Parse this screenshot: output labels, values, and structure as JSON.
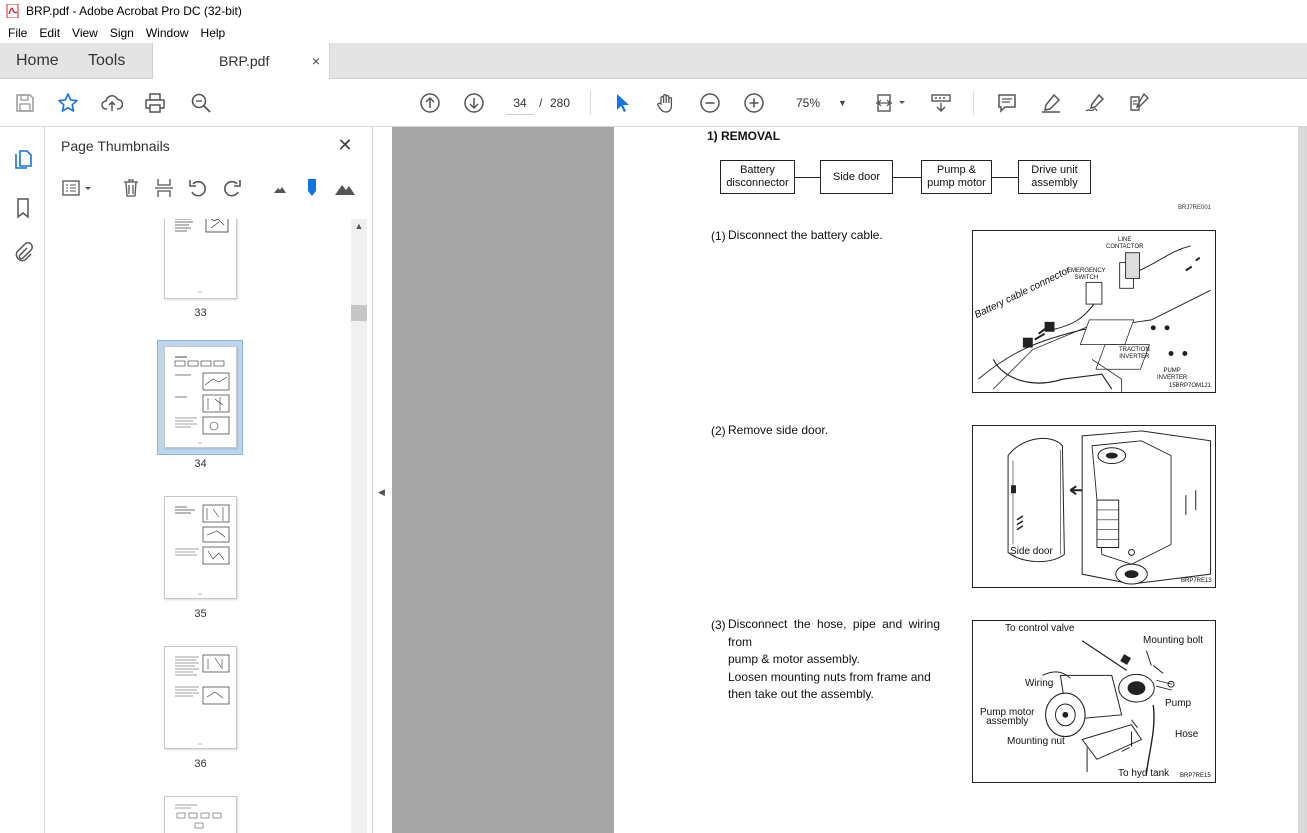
{
  "window": {
    "title": "BRP.pdf - Adobe Acrobat Pro DC (32-bit)",
    "accent_color": "#d4242b"
  },
  "menu": [
    "File",
    "Edit",
    "View",
    "Sign",
    "Window",
    "Help"
  ],
  "tabs": {
    "home": "Home",
    "tools": "Tools",
    "document": "BRP.pdf",
    "close_symbol": "×"
  },
  "toolbar": {
    "current_page": "34",
    "page_separator": "/",
    "total_pages": "280",
    "zoom": "75%",
    "icons": [
      "save-icon",
      "star-icon",
      "upload-icon",
      "print-icon",
      "find-icon",
      "page-up-icon",
      "page-down-icon",
      "select-arrow-icon",
      "hand-icon",
      "zoom-out-icon",
      "zoom-in-icon",
      "fit-page-icon",
      "scroll-mode-icon",
      "comment-icon",
      "highlight-icon",
      "sign-icon",
      "edit-pdf-icon"
    ]
  },
  "thumbnails_panel": {
    "title": "Page Thumbnails",
    "close_symbol": "✕",
    "pages": [
      {
        "label": "33",
        "selected": false
      },
      {
        "label": "34",
        "selected": true
      },
      {
        "label": "35",
        "selected": false
      },
      {
        "label": "36",
        "selected": false
      },
      {
        "label": "",
        "selected": false
      }
    ]
  },
  "document": {
    "heading": "1) REMOVAL",
    "flow": [
      {
        "line1": "Battery",
        "line2": "disconnector"
      },
      {
        "line1": "Side door",
        "line2": ""
      },
      {
        "line1": "Pump &",
        "line2": "pump motor"
      },
      {
        "line1": "Drive unit",
        "line2": "assembly"
      }
    ],
    "flow_code": "BRJ7RE001",
    "steps": [
      {
        "num": "(1)",
        "text": "Disconnect the battery cable.",
        "figure_code": "15BRP7OM121",
        "labels": {
          "line_contactor_1": "LINE",
          "line_contactor_2": "CONTACTOR",
          "emergency_1": "EMERGENCY",
          "emergency_2": "SWITCH",
          "battery_cable": "Battery cable connector",
          "traction_1": "TRACTION",
          "traction_2": "INVERTER",
          "pump_inv_1": "PUMP",
          "pump_inv_2": "INVERTER"
        }
      },
      {
        "num": "(2)",
        "text": "Remove side door.",
        "figure_code": "BRP7RE13",
        "labels": {
          "side_door": "Side door"
        }
      },
      {
        "num": "(3)",
        "line1": "Disconnect the hose, pipe and wiring from",
        "line2": "pump & motor assembly.",
        "line3": "Loosen mounting nuts from frame and",
        "line4": "then take out the assembly.",
        "figure_code": "BRP7RE15",
        "labels": {
          "control_valve": "To control valve",
          "mounting_bolt": "Mounting bolt",
          "wiring": "Wiring",
          "pump": "Pump",
          "pump_motor_1": "Pump motor",
          "pump_motor_2": "assembly",
          "hose": "Hose",
          "mounting_nut": "Mounting nut",
          "hyd_tank": "To hyd tank"
        }
      }
    ]
  }
}
